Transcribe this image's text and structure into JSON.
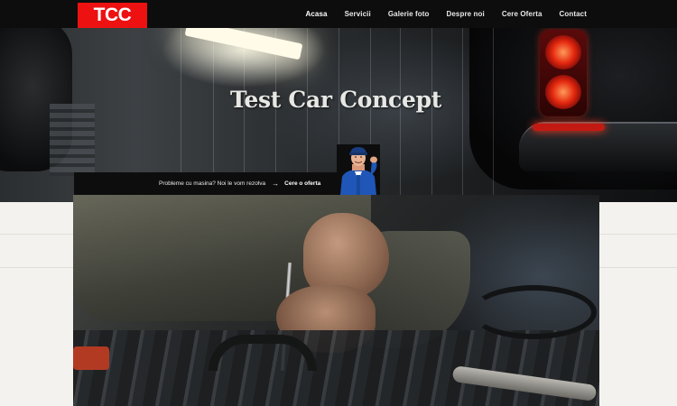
{
  "brand": {
    "logo_text": "TCC",
    "logo_color": "#ee1111"
  },
  "nav": {
    "items": [
      {
        "label": "Acasa",
        "active": true
      },
      {
        "label": "Servicii"
      },
      {
        "label": "Galerie foto"
      },
      {
        "label": "Despre noi"
      },
      {
        "label": "Cere Oferta"
      },
      {
        "label": "Contact"
      }
    ]
  },
  "hero": {
    "title": "Test Car Concept"
  },
  "cta": {
    "text": "Probleme cu masina? Noi le vom rezolva",
    "arrow": "→",
    "link_label": "Cere o oferta"
  },
  "icons": {
    "mechanic": "mechanic-thumbs-up-illustration"
  },
  "colors": {
    "navbar_bg": "#0d0d0d",
    "page_bg": "#f3f1ec"
  }
}
